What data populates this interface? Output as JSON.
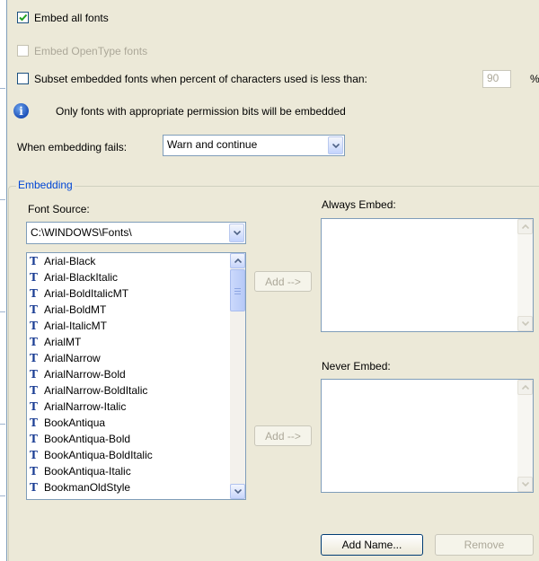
{
  "options": {
    "embed_all": {
      "label": "Embed all fonts",
      "checked": true
    },
    "embed_opentype": {
      "label": "Embed OpenType fonts",
      "checked": false,
      "enabled": false
    },
    "subset": {
      "label": "Subset embedded fonts when percent of characters used is less than:",
      "checked": false,
      "percent_value": "90",
      "percent_unit": "%"
    },
    "info_text": "Only fonts with appropriate permission bits will be embedded",
    "fail": {
      "label": "When embedding fails:",
      "value": "Warn and continue"
    }
  },
  "embedding": {
    "title": "Embedding",
    "font_source_label": "Font Source:",
    "font_source_value": "C:\\WINDOWS\\Fonts\\",
    "fonts": [
      "Arial-Black",
      "Arial-BlackItalic",
      "Arial-BoldItalicMT",
      "Arial-BoldMT",
      "Arial-ItalicMT",
      "ArialMT",
      "ArialNarrow",
      "ArialNarrow-Bold",
      "ArialNarrow-BoldItalic",
      "ArialNarrow-Italic",
      "BookAntiqua",
      "BookAntiqua-Bold",
      "BookAntiqua-BoldItalic",
      "BookAntiqua-Italic",
      "BookmanOldStyle"
    ],
    "font_icon_glyph": "T",
    "add_label": "Add -->",
    "always_embed_label": "Always Embed:",
    "never_embed_label": "Never Embed:",
    "add_name_label": "Add Name...",
    "remove_label": "Remove"
  },
  "colors": {
    "background": "#ece9d8",
    "accent_blue": "#0046d5",
    "check_green": "#21a121",
    "disabled_text": "#aca899"
  }
}
